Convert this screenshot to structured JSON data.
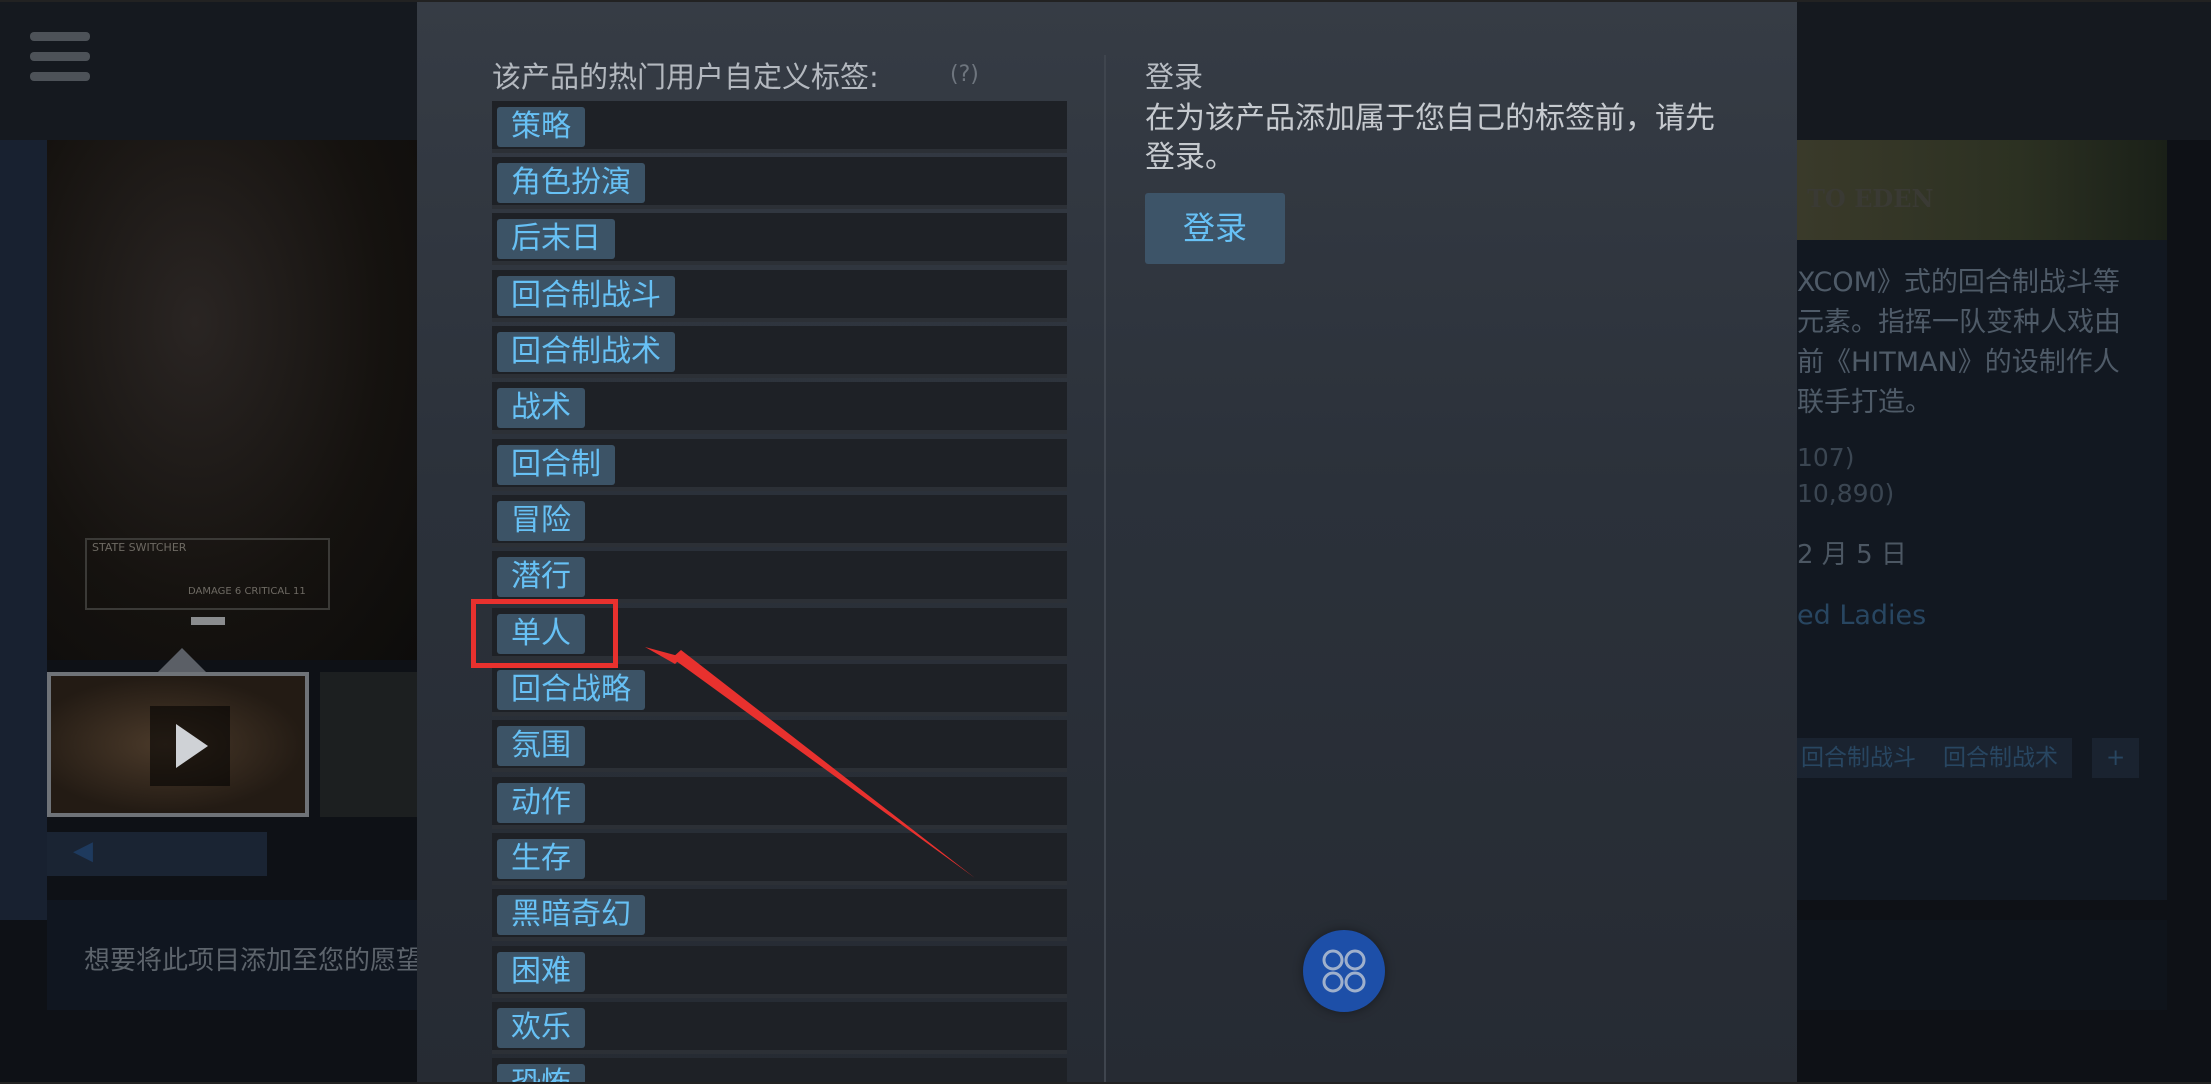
{
  "background": {
    "hud_title": "STATE SWITCHER",
    "hud_stats": "DAMAGE 6   CRITICAL 11",
    "scroll_arrow": "◀",
    "wishlist_prompt": "想要将此项目添加至您的愿望",
    "banner_text": "TO EDEN",
    "description": "XCOM》式的回合制战斗等元素。指挥一队变种人戏由前《HITMAN》的设制作人联手打造。",
    "review_count_1": "107)",
    "review_count_2": "10,890)",
    "release_date": "2 月 5 日",
    "developer": "ed Ladies",
    "tags": [
      "回合制战斗",
      "回合制战术",
      "+"
    ]
  },
  "modal": {
    "tags_heading": "该产品的热门用户自定义标签:",
    "help_icon": "(?)",
    "tags": [
      "策略",
      "角色扮演",
      "后末日",
      "回合制战斗",
      "回合制战术",
      "战术",
      "回合制",
      "冒险",
      "潜行",
      "单人",
      "回合战略",
      "氛围",
      "动作",
      "生存",
      "黑暗奇幻",
      "困难",
      "欢乐",
      "恐怖"
    ],
    "highlighted_tag": "单人",
    "login": {
      "title": "登录",
      "description": "在为该产品添加属于您自己的标签前，请先登录。",
      "button": "登录"
    },
    "fab_icon": "apps-icon"
  },
  "colors": {
    "tag_text": "#67c1f5",
    "tag_bg": "#3c5366",
    "highlight": "#e8312e",
    "fab": "#1d4fa8"
  }
}
